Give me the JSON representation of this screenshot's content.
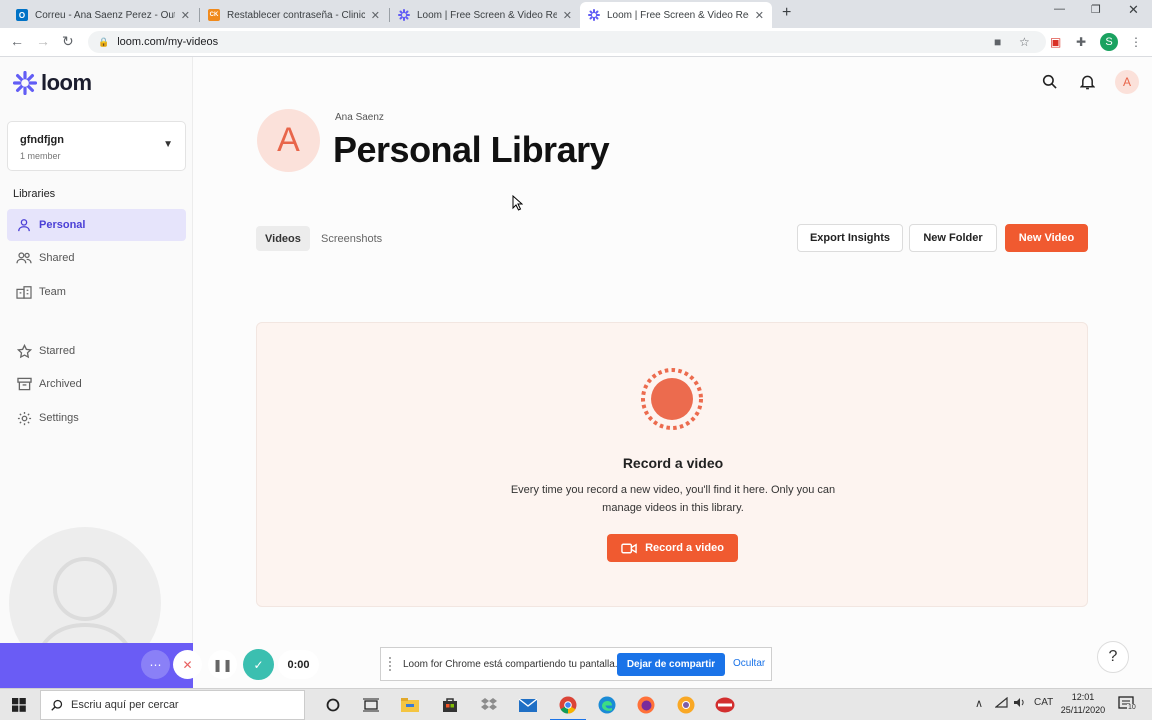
{
  "browser": {
    "tabs": [
      {
        "title": "Correu - Ana Saenz Perez - Outlook",
        "favicon_color": "#0072c6",
        "favicon_text": "O"
      },
      {
        "title": "Restablecer contraseña - Clinicalkey",
        "favicon_color": "#f08a1c",
        "favicon_text": "CK"
      },
      {
        "title": "Loom | Free Screen & Video Recording",
        "favicon_color": "#625df5",
        "favicon_text": ""
      },
      {
        "title": "Loom | Free Screen & Video Recording",
        "favicon_color": "#625df5",
        "favicon_text": ""
      }
    ],
    "url": "loom.com/my-videos",
    "profile_initial": "S"
  },
  "sidebar": {
    "logo": "loom",
    "workspace": {
      "name": "gfndfjgn",
      "members": "1 member"
    },
    "libraries_heading": "Libraries",
    "items": [
      {
        "label": "Personal",
        "icon": "person-icon",
        "active": true
      },
      {
        "label": "Shared",
        "icon": "people-icon",
        "active": false
      },
      {
        "label": "Team",
        "icon": "building-icon",
        "active": false
      },
      {
        "label": "Starred",
        "icon": "star-icon",
        "active": false
      },
      {
        "label": "Archived",
        "icon": "archive-icon",
        "active": false
      },
      {
        "label": "Settings",
        "icon": "gear-icon",
        "active": false
      }
    ]
  },
  "header": {
    "avatar_initial": "A"
  },
  "library": {
    "owner": "Ana Saenz",
    "avatar_initial": "A",
    "title": "Personal Library",
    "tabs": [
      "Videos",
      "Screenshots"
    ],
    "actions": {
      "export": "Export Insights",
      "new_folder": "New Folder",
      "new_video": "New Video"
    }
  },
  "empty_state": {
    "title": "Record a video",
    "description": "Every time you record a new video, you'll find it here. Only you can manage videos in this library.",
    "button": "Record a video"
  },
  "recorder": {
    "timer": "0:00"
  },
  "share_notice": {
    "text": "Loom for Chrome está compartiendo tu pantalla.",
    "stop": "Dejar de compartir",
    "hide": "Ocultar"
  },
  "taskbar": {
    "search_placeholder": "Escriu aquí per cercar",
    "language": "CAT",
    "time": "12:01",
    "date": "25/11/2020",
    "notifications": "10"
  },
  "colors": {
    "accent": "#625df5",
    "primary": "#f05a30",
    "empty_bg": "#fdf4f0"
  }
}
